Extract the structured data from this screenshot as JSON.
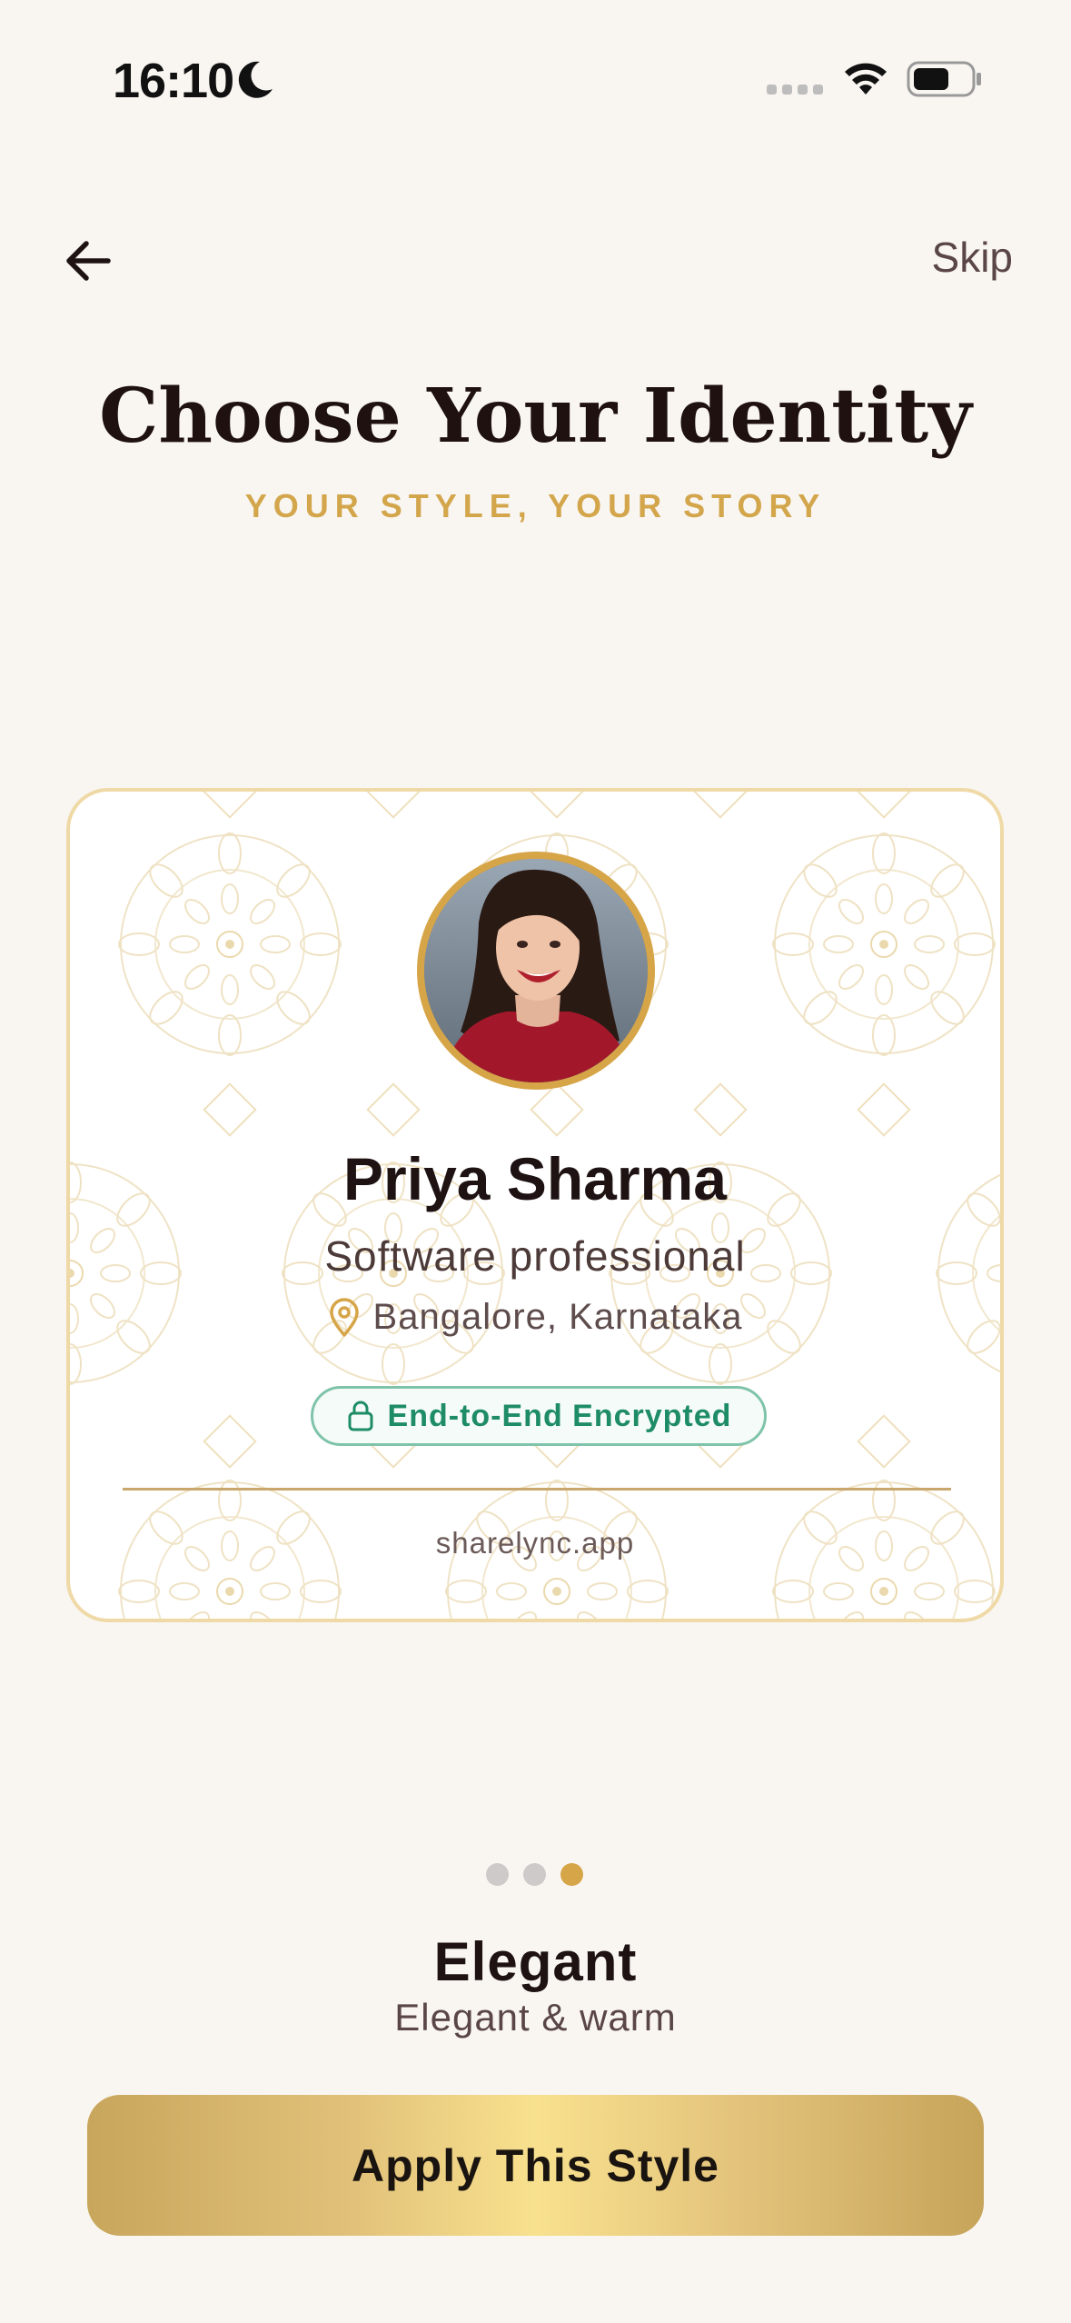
{
  "status_bar": {
    "time": "16:10"
  },
  "nav": {
    "skip_label": "Skip"
  },
  "header": {
    "title": "Choose Your Identity",
    "subtitle": "YOUR STYLE, YOUR STORY"
  },
  "card": {
    "name": "Priya Sharma",
    "role": "Software professional",
    "location": "Bangalore, Karnataka",
    "badge": "End-to-End Encrypted",
    "url": "sharelync.app"
  },
  "pager": {
    "count": 3,
    "active_index": 2
  },
  "style": {
    "name": "Elegant",
    "description": "Elegant & warm"
  },
  "cta": {
    "label": "Apply This Style"
  },
  "colors": {
    "accent_gold": "#D6A548",
    "badge_green": "#1E8C66",
    "background": "#F9F6F2"
  },
  "icons": [
    "moon-icon",
    "wifi-icon",
    "battery-icon",
    "back-arrow-icon",
    "location-pin-icon",
    "lock-icon"
  ]
}
